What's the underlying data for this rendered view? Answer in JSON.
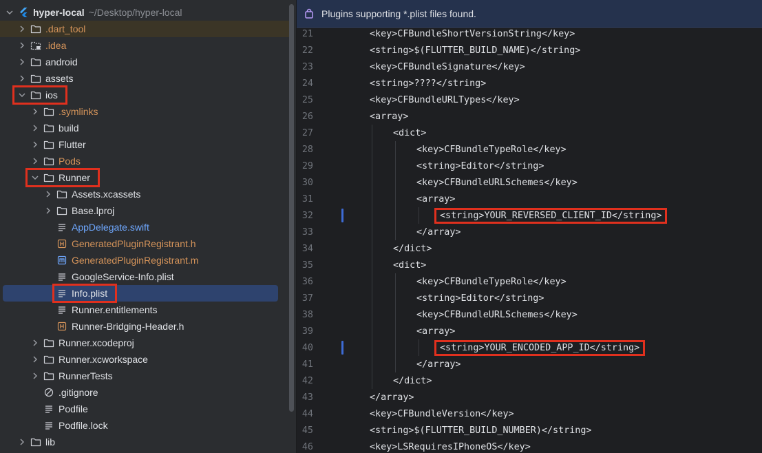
{
  "project": {
    "name": "hyper-local",
    "path": "~/Desktop/hyper-local"
  },
  "tree": [
    {
      "label": ".dart_tool",
      "kind": "folder",
      "depth": 1,
      "state": "collapsed",
      "color": "orange",
      "excluded": true
    },
    {
      "label": ".idea",
      "kind": "folder-dotted",
      "depth": 1,
      "state": "collapsed",
      "color": "orange"
    },
    {
      "label": "android",
      "kind": "folder",
      "depth": 1,
      "state": "collapsed"
    },
    {
      "label": "assets",
      "kind": "folder",
      "depth": 1,
      "state": "collapsed"
    },
    {
      "label": "ios",
      "kind": "folder",
      "depth": 1,
      "state": "expanded"
    },
    {
      "label": ".symlinks",
      "kind": "folder",
      "depth": 2,
      "state": "collapsed",
      "color": "orange"
    },
    {
      "label": "build",
      "kind": "folder",
      "depth": 2,
      "state": "collapsed"
    },
    {
      "label": "Flutter",
      "kind": "folder",
      "depth": 2,
      "state": "collapsed"
    },
    {
      "label": "Pods",
      "kind": "folder",
      "depth": 2,
      "state": "collapsed",
      "color": "orange"
    },
    {
      "label": "Runner",
      "kind": "folder",
      "depth": 2,
      "state": "expanded"
    },
    {
      "label": "Assets.xcassets",
      "kind": "folder",
      "depth": 3,
      "state": "collapsed"
    },
    {
      "label": "Base.lproj",
      "kind": "folder",
      "depth": 3,
      "state": "collapsed"
    },
    {
      "label": "AppDelegate.swift",
      "kind": "file-text",
      "depth": 3,
      "color": "blue"
    },
    {
      "label": "GeneratedPluginRegistrant.h",
      "kind": "file-h",
      "depth": 3,
      "color": "orange"
    },
    {
      "label": "GeneratedPluginRegistrant.m",
      "kind": "file-m",
      "depth": 3,
      "color": "orange"
    },
    {
      "label": "GoogleService-Info.plist",
      "kind": "file-text",
      "depth": 3
    },
    {
      "label": "Info.plist",
      "kind": "file-text",
      "depth": 3,
      "selected": true
    },
    {
      "label": "Runner.entitlements",
      "kind": "file-text",
      "depth": 3
    },
    {
      "label": "Runner-Bridging-Header.h",
      "kind": "file-h",
      "depth": 3
    },
    {
      "label": "Runner.xcodeproj",
      "kind": "folder",
      "depth": 2,
      "state": "collapsed"
    },
    {
      "label": "Runner.xcworkspace",
      "kind": "folder",
      "depth": 2,
      "state": "collapsed"
    },
    {
      "label": "RunnerTests",
      "kind": "folder",
      "depth": 2,
      "state": "collapsed"
    },
    {
      "label": ".gitignore",
      "kind": "file-ignore",
      "depth": 2
    },
    {
      "label": "Podfile",
      "kind": "file-text",
      "depth": 2
    },
    {
      "label": "Podfile.lock",
      "kind": "file-text",
      "depth": 2
    },
    {
      "label": "lib",
      "kind": "folder",
      "depth": 1,
      "state": "collapsed"
    }
  ],
  "banner": {
    "text": "Plugins supporting *.plist files found.",
    "icon": "plugin-bag-icon"
  },
  "editor": {
    "lines": [
      {
        "num": "21",
        "indent": 1,
        "text": "<key>CFBundleShortVersionString</key>"
      },
      {
        "num": "22",
        "indent": 1,
        "text": "<string>$(FLUTTER_BUILD_NAME)</string>"
      },
      {
        "num": "23",
        "indent": 1,
        "text": "<key>CFBundleSignature</key>"
      },
      {
        "num": "24",
        "indent": 1,
        "text": "<string>????</string>"
      },
      {
        "num": "25",
        "indent": 1,
        "text": "<key>CFBundleURLTypes</key>"
      },
      {
        "num": "26",
        "indent": 1,
        "text": "<array>"
      },
      {
        "num": "27",
        "indent": 2,
        "text": "<dict>"
      },
      {
        "num": "28",
        "indent": 3,
        "text": "<key>CFBundleTypeRole</key>"
      },
      {
        "num": "29",
        "indent": 3,
        "text": "<string>Editor</string>"
      },
      {
        "num": "30",
        "indent": 3,
        "text": "<key>CFBundleURLSchemes</key>"
      },
      {
        "num": "31",
        "indent": 3,
        "text": "<array>"
      },
      {
        "num": "32",
        "indent": 4,
        "text": "<string>YOUR_REVERSED_CLIENT_ID</string>",
        "changed": true,
        "highlighted": true
      },
      {
        "num": "33",
        "indent": 3,
        "text": "</array>"
      },
      {
        "num": "34",
        "indent": 2,
        "text": "</dict>"
      },
      {
        "num": "35",
        "indent": 2,
        "text": "<dict>"
      },
      {
        "num": "36",
        "indent": 3,
        "text": "<key>CFBundleTypeRole</key>"
      },
      {
        "num": "37",
        "indent": 3,
        "text": "<string>Editor</string>"
      },
      {
        "num": "38",
        "indent": 3,
        "text": "<key>CFBundleURLSchemes</key>"
      },
      {
        "num": "39",
        "indent": 3,
        "text": "<array>"
      },
      {
        "num": "40",
        "indent": 4,
        "text": "<string>YOUR_ENCODED_APP_ID</string>",
        "changed": true,
        "highlighted": true
      },
      {
        "num": "41",
        "indent": 3,
        "text": "</array>"
      },
      {
        "num": "42",
        "indent": 2,
        "text": "</dict>"
      },
      {
        "num": "43",
        "indent": 1,
        "text": "</array>"
      },
      {
        "num": "44",
        "indent": 1,
        "text": "<key>CFBundleVersion</key>"
      },
      {
        "num": "45",
        "indent": 1,
        "text": "<string>$(FLUTTER_BUILD_NUMBER)</string>"
      },
      {
        "num": "46",
        "indent": 1,
        "text": "<key>LSRequiresIPhoneOS</key>"
      }
    ]
  },
  "annotations": {
    "highlighted_tree_items": [
      "ios",
      "Runner",
      "Info.plist"
    ],
    "highlight_color": "#e0301e"
  },
  "colors": {
    "tree_bg": "#2b2d30",
    "editor_bg": "#1e1f22",
    "selection": "#2e436e",
    "excluded_folder": "#d5945a",
    "swift_file": "#6fa8ff",
    "banner_bg": "#25324d",
    "vcs_change": "#3d6bd5"
  }
}
